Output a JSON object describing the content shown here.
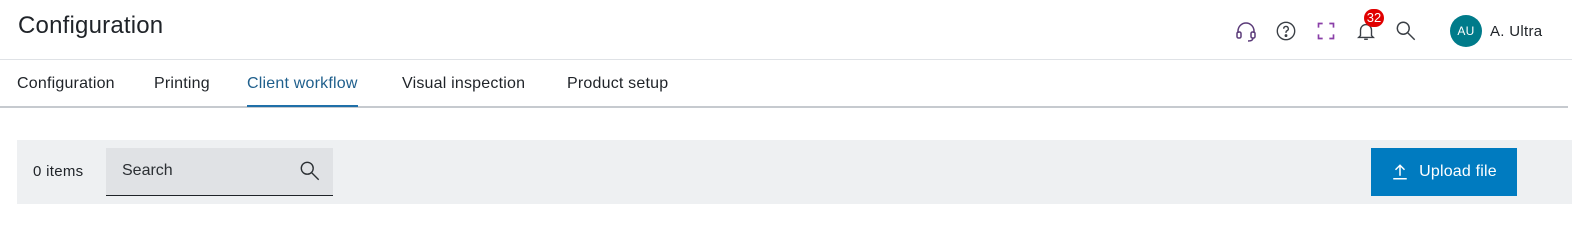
{
  "header": {
    "title": "Configuration",
    "icons": {
      "support": "headset-icon",
      "help": "help-circle-icon",
      "fullscreen": "fullscreen-icon",
      "notifications": "bell-icon",
      "search": "search-icon"
    },
    "notification_count": "32",
    "user": {
      "initials": "AU",
      "name": "A. Ultra"
    }
  },
  "tabs": [
    {
      "label": "Configuration",
      "active": false
    },
    {
      "label": "Printing",
      "active": false
    },
    {
      "label": "Client workflow",
      "active": true
    },
    {
      "label": "Visual inspection",
      "active": false
    },
    {
      "label": "Product setup",
      "active": false
    }
  ],
  "toolbar": {
    "item_count": "0 items",
    "search_placeholder": "Search",
    "upload_label": "Upload file"
  },
  "colors": {
    "accent": "#007bc0",
    "active_tab": "#1f5f8c",
    "badge": "#e00000",
    "avatar": "#007b8a",
    "toolbar_bg": "#eef0f2"
  }
}
